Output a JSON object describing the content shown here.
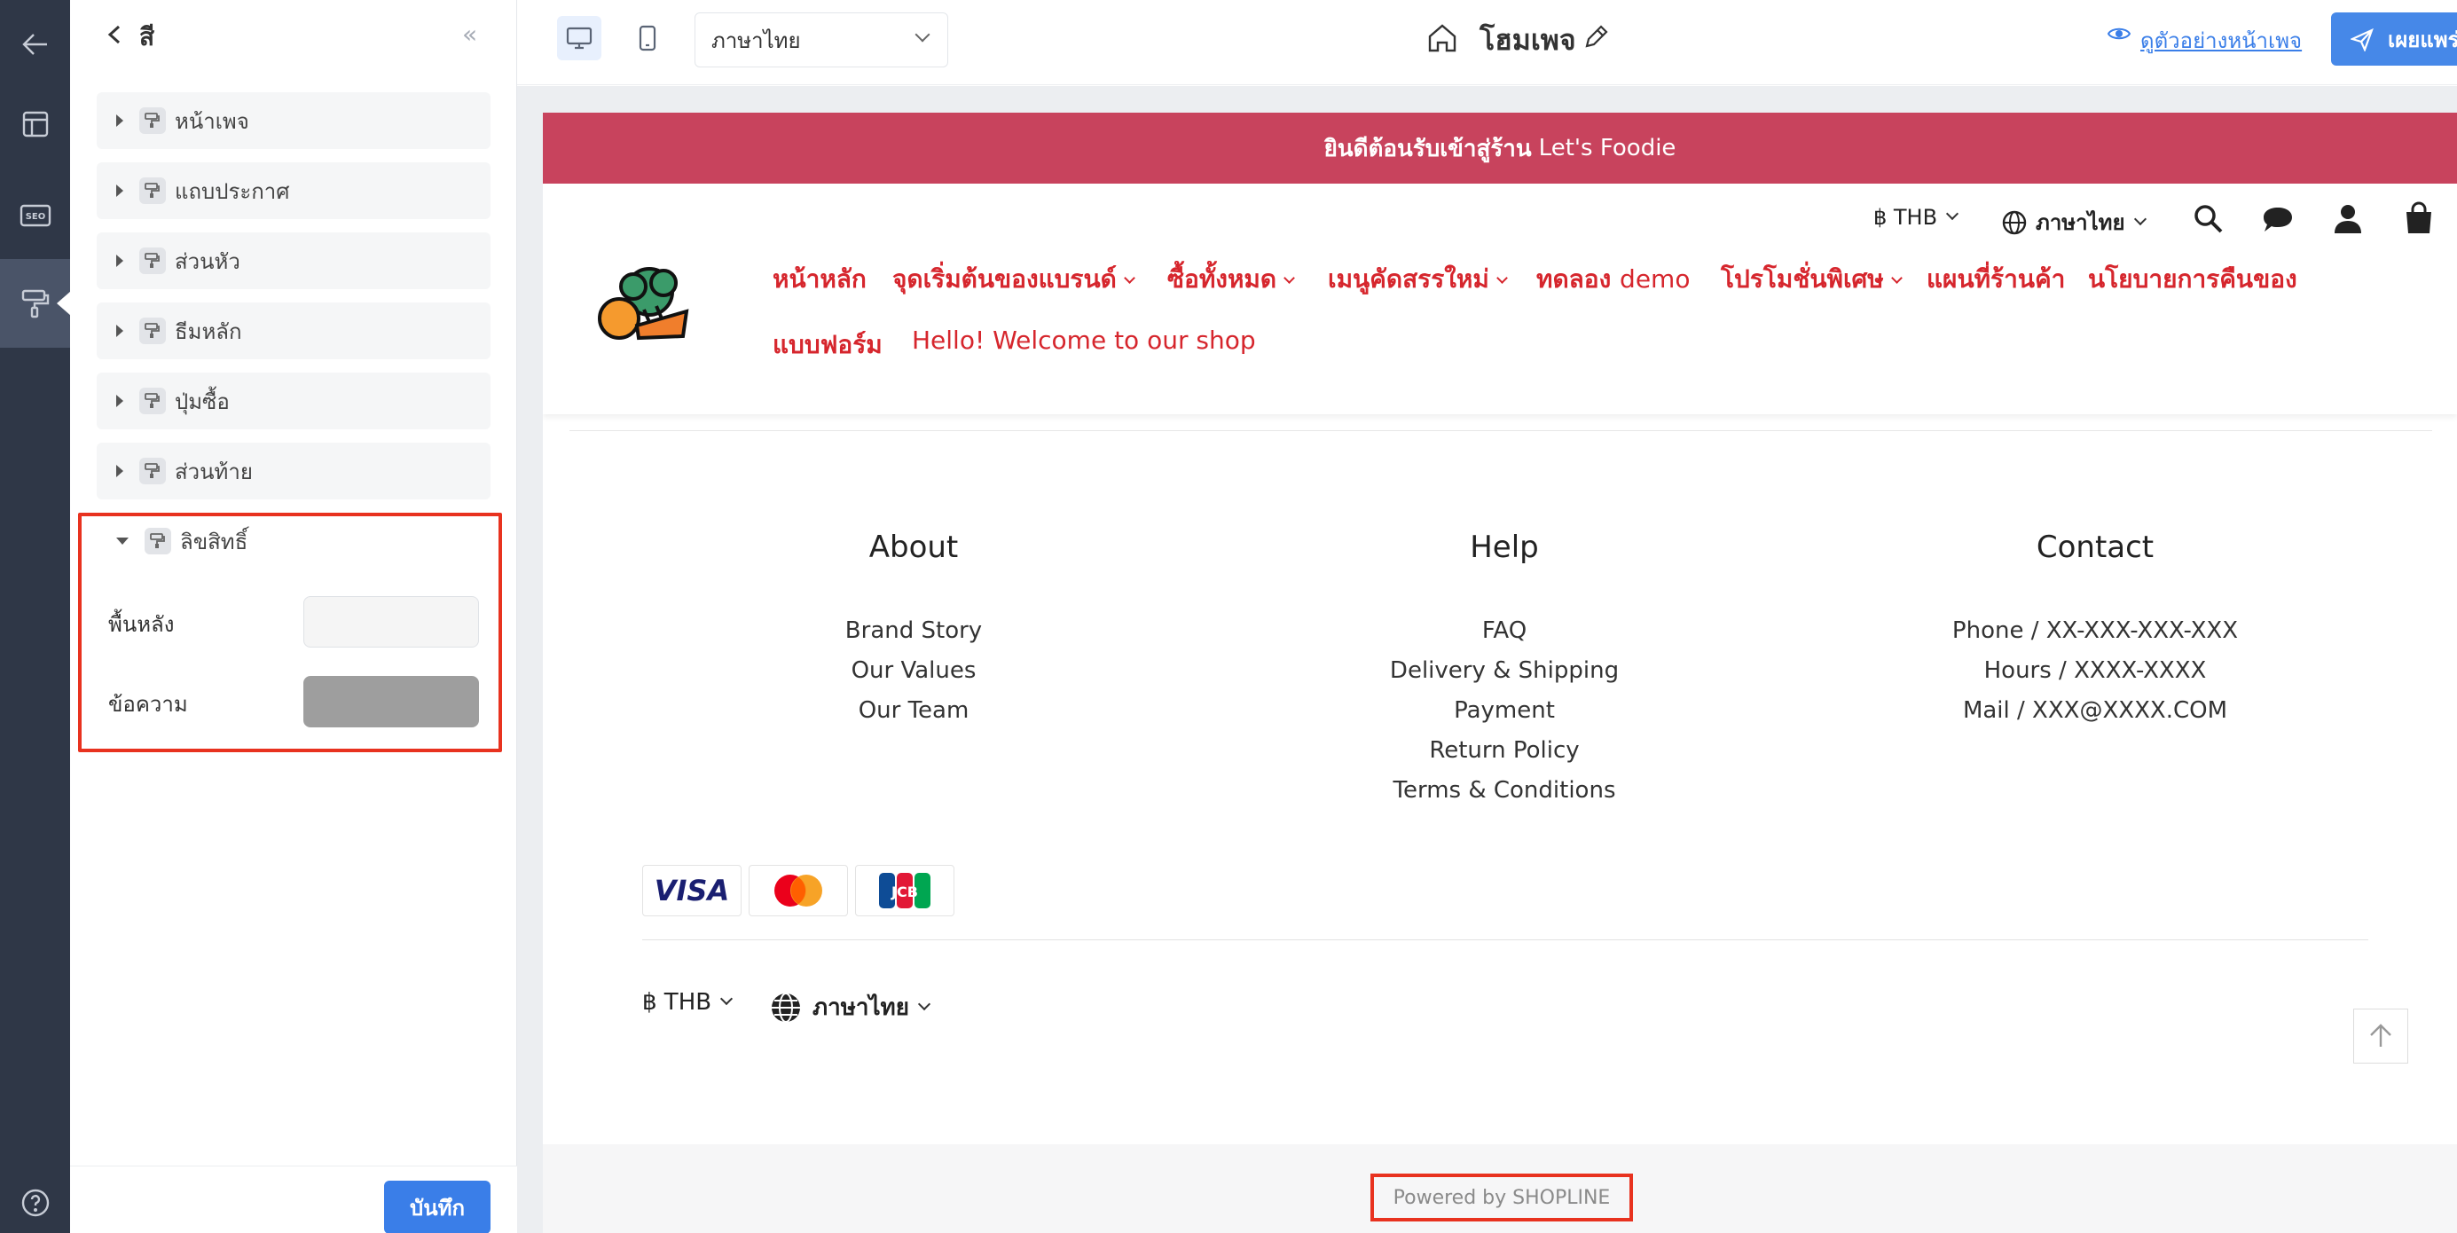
{
  "rail": {
    "items": [
      {
        "name": "back",
        "icon": "arrow-left-icon"
      },
      {
        "name": "layout",
        "icon": "layout-icon"
      },
      {
        "name": "seo",
        "label": "SEO",
        "icon": "seo-icon"
      },
      {
        "name": "theme",
        "icon": "paint-roller-icon",
        "active": true
      },
      {
        "name": "help",
        "icon": "help-icon"
      }
    ]
  },
  "panel": {
    "title": "สี",
    "groups": [
      {
        "label": "หน้าเพจ",
        "expanded": false
      },
      {
        "label": "แถบประกาศ",
        "expanded": false
      },
      {
        "label": "ส่วนหัว",
        "expanded": false
      },
      {
        "label": "ธีมหลัก",
        "expanded": false
      },
      {
        "label": "ปุ่มซื้อ",
        "expanded": false
      },
      {
        "label": "ส่วนท้าย",
        "expanded": false
      },
      {
        "label": "ลิขสิทธิ์",
        "expanded": true
      }
    ],
    "copyright_fields": [
      {
        "label": "พื้นหลัง",
        "color": "#f5f5f5"
      },
      {
        "label": "ข้อความ",
        "color": "#9e9e9e"
      }
    ],
    "save_label": "บันทึก"
  },
  "toolbar": {
    "language": "ภาษาไทย",
    "page_name": "โฮมเพจ",
    "preview_label": "ดูตัวอย่างหน้าเพจ",
    "publish_label": "เผยแพร่"
  },
  "store": {
    "announcement_prefix": "ยินดีต้อนรับเข้าสู่ร้าน",
    "announcement_brand": "Let's Foodie",
    "currency": "฿ THB",
    "language": "ภาษาไทย",
    "nav": [
      {
        "label": "หน้าหลัก",
        "dropdown": false
      },
      {
        "label": "จุดเริ่มต้นของแบรนด์",
        "dropdown": true
      },
      {
        "label": "ซื้อทั้งหมด",
        "dropdown": true
      },
      {
        "label": "เมนูคัดสรรใหม่",
        "dropdown": true
      },
      {
        "label": "ทดลอง demo",
        "dropdown": false
      },
      {
        "label": "โปรโมชั่นพิเศษ",
        "dropdown": true
      },
      {
        "label": "แผนที่ร้านค้า",
        "dropdown": false
      },
      {
        "label": "นโยบายการคืนของ",
        "dropdown": false
      },
      {
        "label": "แบบฟอร์ม",
        "dropdown": false
      },
      {
        "label": "Hello! Welcome to our shop",
        "dropdown": false
      }
    ],
    "footer": {
      "columns": [
        {
          "title": "About",
          "links": [
            "Brand Story",
            "Our Values",
            "Our Team"
          ]
        },
        {
          "title": "Help",
          "links": [
            "FAQ",
            "Delivery & Shipping",
            "Payment",
            "Return Policy",
            "Terms & Conditions"
          ]
        },
        {
          "title": "Contact",
          "links": [
            "Phone / XX-XXX-XXX-XXX",
            "Hours / XXXX-XXXX",
            "Mail / XXX@XXXX.COM"
          ]
        }
      ],
      "payments": [
        "VISA",
        "Mastercard",
        "JCB"
      ],
      "currency": "฿ THB",
      "language": "ภาษาไทย",
      "powered_by": "Powered by SHOPLINE"
    }
  },
  "colors": {
    "rail": "#2f3747",
    "accent": "#3a7ee8",
    "announcement": "#c8435d",
    "nav_text": "#d6262d",
    "highlight": "#e8321f"
  }
}
